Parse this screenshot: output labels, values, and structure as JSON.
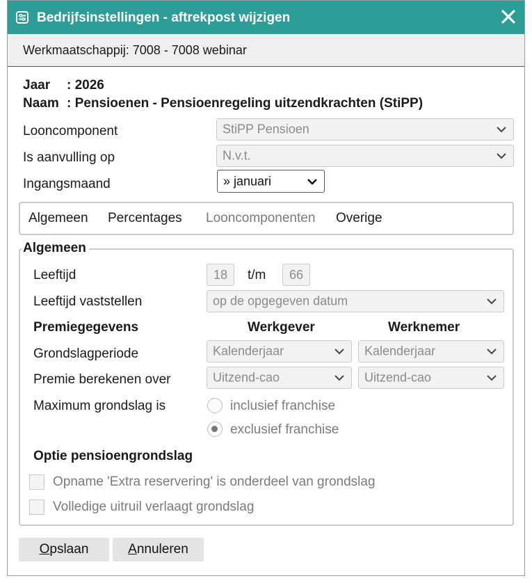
{
  "window": {
    "title": "Bedrijfsinstellingen - aftrekpost wijzigen",
    "close_icon": "close-icon",
    "title_icon": "settings-icon"
  },
  "company": {
    "line": "Werkmaatschappij:  7008  -  7008 webinar"
  },
  "header": {
    "jaar_label": "Jaar",
    "jaar_value": ": 2026",
    "naam_label": "Naam",
    "naam_value": ": Pensioenen - Pensioenregeling uitzendkrachten (StiPP)"
  },
  "form": {
    "looncomponent_label": "Looncomponent",
    "looncomponent_value": "StiPP Pensioen",
    "aanvulling_label": "Is aanvulling op",
    "aanvulling_value": "N.v.t.",
    "ingangsmaand_label": "Ingangsmaand",
    "ingangsmaand_value": "» januari"
  },
  "tabs": [
    {
      "label": "Algemeen"
    },
    {
      "label": "Percentages"
    },
    {
      "label": "Looncomponenten"
    },
    {
      "label": "Overige"
    }
  ],
  "algemeen": {
    "legend": "Algemeen",
    "leeftijd_label": "Leeftijd",
    "leeftijd_from": "18",
    "leeftijd_sep": "t/m",
    "leeftijd_to": "66",
    "vaststellen_label": "Leeftijd vaststellen",
    "vaststellen_value": "op de opgegeven datum",
    "premie_heading": "Premiegegevens",
    "werkgever_heading": "Werkgever",
    "werknemer_heading": "Werknemer",
    "grondslagperiode_label": "Grondslagperiode",
    "grondslagperiode_wg": "Kalenderjaar",
    "grondslagperiode_wn": "Kalenderjaar",
    "premie_over_label": "Premie berekenen over",
    "premie_over_wg": "Uitzend-cao",
    "premie_over_wn": "Uitzend-cao",
    "max_grondslag_label": "Maximum grondslag is",
    "radio_inclusief": "inclusief franchise",
    "radio_exclusief": "exclusief franchise",
    "selected_radio": "exclusief franchise",
    "optie_heading": "Optie pensioengrondslag",
    "check_extra": "Opname 'Extra reservering' is onderdeel van grondslag",
    "check_uitruil": "Volledige uitruil verlaagt grondslag"
  },
  "buttons": {
    "save_first": "O",
    "save_rest": "pslaan",
    "cancel_first": "A",
    "cancel_rest": "nnuleren"
  },
  "colors": {
    "titlebar": "#2e9c97",
    "header_bg": "#efefef"
  }
}
